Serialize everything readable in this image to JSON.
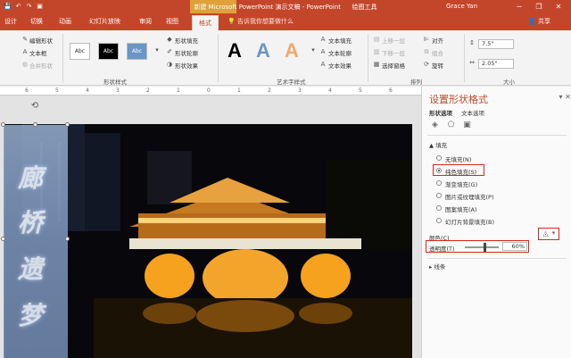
{
  "titlebar": {
    "title": "新建 Microsoft PowerPoint 演示文稿 - PowerPoint",
    "context_tool": "绘图工具",
    "user": "Grace Yan",
    "minimize": "─",
    "restore": "❐",
    "close": "✕",
    "qat_save": "💾",
    "qat_undo": "↶",
    "qat_redo": "↷",
    "qat_present": "▣"
  },
  "tabs": [
    {
      "label": "设计"
    },
    {
      "label": "切换"
    },
    {
      "label": "动画"
    },
    {
      "label": "幻灯片放映"
    },
    {
      "label": "审阅"
    },
    {
      "label": "视图"
    },
    {
      "label": "格式"
    }
  ],
  "tell_me": "告诉我你想要做什么",
  "share": "共享",
  "ribbon": {
    "edit_shape": "编辑形状",
    "text_box": "文本框",
    "merge_shapes": "合并形状",
    "style_swatches": [
      "Abc",
      "Abc",
      "Abc"
    ],
    "shape_fill": "形状填充",
    "shape_outline": "形状轮廓",
    "shape_effects": "形状效果",
    "group_shape_styles": "形状样式",
    "wordart_letters": [
      "A",
      "A",
      "A"
    ],
    "text_fill": "文本填充",
    "text_outline": "文本轮廓",
    "text_effects": "文本效果",
    "group_wordart": "艺术字样式",
    "bring_forward": "上移一层",
    "send_backward": "下移一层",
    "selection_pane": "选择窗格",
    "align": "对齐",
    "group": "组合",
    "rotate": "旋转",
    "group_arrange": "排列",
    "height_value": "7.5\"",
    "width_value": "2.05\"",
    "group_size": "大小"
  },
  "ruler": {
    "numbers": [
      "6",
      "5",
      "4",
      "3",
      "2",
      "1",
      "0",
      "1",
      "2",
      "3",
      "4",
      "5",
      "6"
    ]
  },
  "slide": {
    "vertical_text": [
      "廊",
      "桥",
      "遗",
      "梦"
    ]
  },
  "pane": {
    "title": "设置形状格式",
    "tab_shape": "形状选项",
    "tab_text": "文本选项",
    "section_fill": "填充",
    "fill_options": [
      {
        "label": "无填充(N)",
        "selected": false
      },
      {
        "label": "纯色填充(S)",
        "selected": true
      },
      {
        "label": "渐变填充(G)",
        "selected": false
      },
      {
        "label": "图片或纹理填充(P)",
        "selected": false
      },
      {
        "label": "图案填充(A)",
        "selected": false
      },
      {
        "label": "幻灯片背景填充(B)",
        "selected": false
      }
    ],
    "color_label": "颜色(C)",
    "transparency_label": "透明度(T)",
    "transparency_value": "60%",
    "transparency_level": 0.6,
    "section_line": "线条",
    "highlight_color": "#d9261c"
  }
}
